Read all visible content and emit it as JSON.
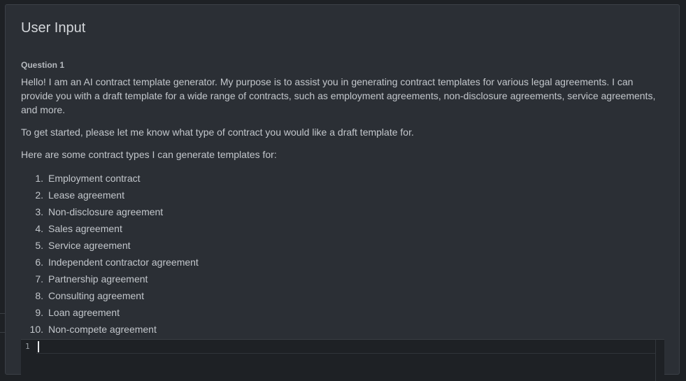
{
  "panel": {
    "title": "User Input"
  },
  "question": {
    "label": "Question 1",
    "paragraphs": [
      "Hello! I am an AI contract template generator. My purpose is to assist you in generating contract templates for various legal agreements. I can provide you with a draft template for a wide range of contracts, such as employment agreements, non-disclosure agreements, service agreements, and more.",
      "To get started, please let me know what type of contract you would like a draft template for.",
      "Here are some contract types I can generate templates for:"
    ],
    "items": [
      {
        "num": "1.",
        "label": "Employment contract"
      },
      {
        "num": "2.",
        "label": "Lease agreement"
      },
      {
        "num": "3.",
        "label": "Non-disclosure agreement"
      },
      {
        "num": "4.",
        "label": "Sales agreement"
      },
      {
        "num": "5.",
        "label": "Service agreement"
      },
      {
        "num": "6.",
        "label": "Independent contractor agreement"
      },
      {
        "num": "7.",
        "label": "Partnership agreement"
      },
      {
        "num": "8.",
        "label": "Consulting agreement"
      },
      {
        "num": "9.",
        "label": "Loan agreement"
      },
      {
        "num": "10.",
        "label": "Non-compete agreement"
      }
    ]
  },
  "editor": {
    "line_number": "1",
    "value": ""
  }
}
